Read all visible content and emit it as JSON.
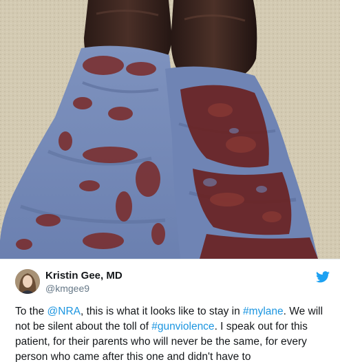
{
  "tweet": {
    "author": {
      "display_name": "Kristin Gee, MD",
      "handle": "@kmgee9"
    },
    "text_parts": {
      "p1": "To the ",
      "mention": "@NRA",
      "p2": ", this is what it looks like to stay in ",
      "hashtag1": "#mylane",
      "p3": ". We will not be silent about the toll of ",
      "hashtag2": "#gunviolence",
      "p4": ". I speak out for this patient, for their parents who will never be the same, for every person who came after this one and didn't have to"
    },
    "icons": {
      "logo": "twitter-bird-icon"
    },
    "colors": {
      "link": "#1b95e0",
      "twitter_blue": "#1da1f2",
      "text": "#14171a",
      "secondary": "#657786"
    }
  }
}
